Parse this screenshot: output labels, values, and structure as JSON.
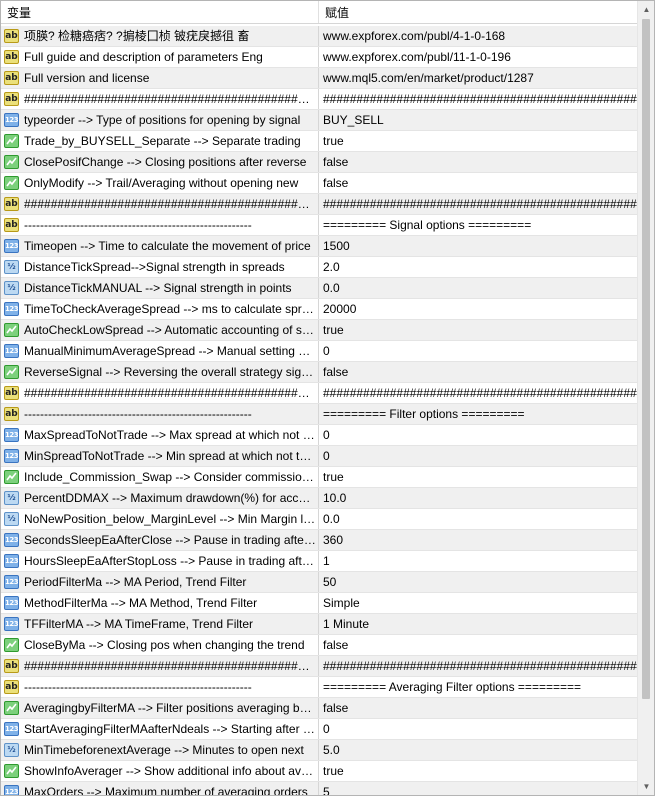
{
  "header": {
    "col_variable": "变量",
    "col_value": "赋值"
  },
  "rows": [
    {
      "type": "str",
      "name": "项朠? 检糖癌痞? ?掮棱囗桢 铍疣戾撼徂 畜",
      "value": "www.expforex.com/publ/4-1-0-168"
    },
    {
      "type": "str",
      "name": "Full guide and description of parameters Eng",
      "value": "www.expforex.com/publ/11-1-0-196"
    },
    {
      "type": "str",
      "name": "Full version and license",
      "value": "www.mql5.com/en/market/product/1287"
    },
    {
      "type": "str",
      "name": "##################################################",
      "value": "##################################################"
    },
    {
      "type": "int",
      "name": "typeorder --> Type of positions for opening by signal",
      "value": "BUY_SELL"
    },
    {
      "type": "bool",
      "name": "Trade_by_BUYSELL_Separate --> Separate trading",
      "value": "true"
    },
    {
      "type": "bool",
      "name": "ClosePosifChange --> Closing positions after reverse",
      "value": "false"
    },
    {
      "type": "bool",
      "name": "OnlyModify --> Trail/Averaging without opening new",
      "value": "false"
    },
    {
      "type": "str",
      "name": "##################################################",
      "value": "##################################################"
    },
    {
      "type": "str",
      "name": "---------------------------------------------------------",
      "value": "=========  Signal  options ========="
    },
    {
      "type": "int",
      "name": "Timeopen --> Time to calculate the movement of price",
      "value": "1500"
    },
    {
      "type": "dbl",
      "name": "DistanceTickSpread-->Signal strength in spreads",
      "value": "2.0"
    },
    {
      "type": "dbl",
      "name": "DistanceTickMANUAL --> Signal strength in points",
      "value": "0.0"
    },
    {
      "type": "int",
      "name": "TimeToCheckAverageSpread --> ms to calculate spread",
      "value": "20000"
    },
    {
      "type": "bool",
      "name": "AutoCheckLowSpread --> Automatic accounting of spread",
      "value": "true"
    },
    {
      "type": "int",
      "name": "ManualMinimumAverageSpread --> Manual setting spread",
      "value": "0"
    },
    {
      "type": "bool",
      "name": "ReverseSignal --> Reversing the overall strategy signal",
      "value": "false"
    },
    {
      "type": "str",
      "name": "##################################################",
      "value": "##################################################"
    },
    {
      "type": "str",
      "name": "---------------------------------------------------------",
      "value": "=========  Filter  options ========="
    },
    {
      "type": "int",
      "name": "MaxSpreadToNotTrade --> Max spread at which not to trade",
      "value": "0"
    },
    {
      "type": "int",
      "name": "MinSpreadToNotTrade --> Min spread at which not to trade",
      "value": "0"
    },
    {
      "type": "bool",
      "name": "Include_Commission_Swap --> Consider commission and swap",
      "value": "true"
    },
    {
      "type": "dbl",
      "name": "PercentDDMAX --> Maximum drawdown(%) for account",
      "value": "10.0"
    },
    {
      "type": "dbl",
      "name": "NoNewPosition_below_MarginLevel --> Min Margin level",
      "value": "0.0"
    },
    {
      "type": "int",
      "name": "SecondsSleepEaAfterClose --> Pause in trading after close",
      "value": "360"
    },
    {
      "type": "int",
      "name": "HoursSleepEaAfterStopLoss --> Pause in trading after stop",
      "value": "1"
    },
    {
      "type": "int",
      "name": "PeriodFilterMa --> MA Period, Trend Filter",
      "value": "50"
    },
    {
      "type": "int",
      "name": "MethodFilterMa --> MA Method, Trend Filter",
      "value": "Simple"
    },
    {
      "type": "int",
      "name": "TFFilterMA --> MA TimeFrame, Trend Filter",
      "value": "1 Minute"
    },
    {
      "type": "bool",
      "name": "CloseByMa --> Closing pos when changing the trend",
      "value": "false"
    },
    {
      "type": "str",
      "name": "##################################################",
      "value": "##################################################"
    },
    {
      "type": "str",
      "name": "---------------------------------------------------------",
      "value": "=========  Averaging Filter  options ========="
    },
    {
      "type": "bool",
      "name": "AveragingbyFilterMA --> Filter positions averaging by MA",
      "value": "false"
    },
    {
      "type": "int",
      "name": "StartAveragingFilterMAafterNdeals --> Starting after N deals",
      "value": "0"
    },
    {
      "type": "dbl",
      "name": "MinTimebeforenextAverage --> Minutes to open next",
      "value": "5.0"
    },
    {
      "type": "bool",
      "name": "ShowInfoAverager --> Show additional info about averaging",
      "value": "true"
    },
    {
      "type": "int",
      "name": "MaxOrders --> Maximum number of averaging orders",
      "value": "5"
    }
  ],
  "type_icons": {
    "str": {
      "icon": "string-type-icon",
      "glyph": "ab"
    },
    "int": {
      "icon": "integer-type-icon",
      "glyph": "123"
    },
    "dbl": {
      "icon": "double-type-icon",
      "glyph": "½"
    },
    "bool": {
      "icon": "boolean-type-icon",
      "glyph": ""
    }
  },
  "colors": {
    "row_even": "#f0f0f0",
    "row_odd": "#ffffff",
    "grid_line": "#e4e4e4"
  }
}
